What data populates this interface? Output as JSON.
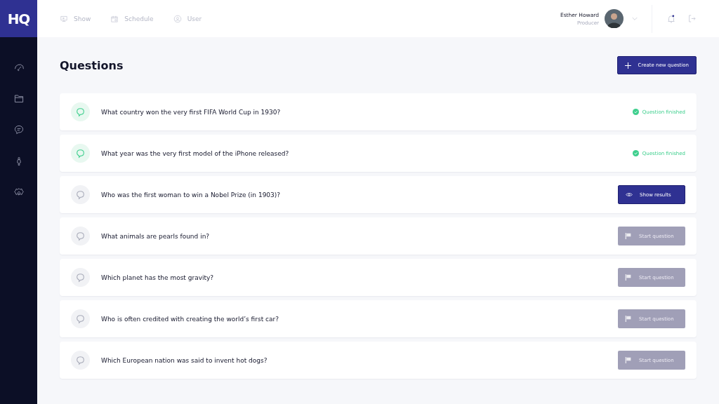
{
  "logo": "HQ",
  "nav": [
    {
      "label": "Show"
    },
    {
      "label": "Schedule"
    },
    {
      "label": "User"
    }
  ],
  "user": {
    "name": "Esther Howard",
    "role": "Producer"
  },
  "notifications": {
    "unread": true
  },
  "page_title": "Questions",
  "create_button": "Create new question",
  "questions": [
    {
      "text": "What country won the very first FIFA World Cup in 1930?",
      "kind": "finished",
      "action": "Question finished"
    },
    {
      "text": "What year was the very first model of the iPhone released?",
      "kind": "finished",
      "action": "Question finished"
    },
    {
      "text": "Who was the first woman to win a Nobel Prize (in 1903)?",
      "kind": "results",
      "action": "Show results"
    },
    {
      "text": "What animals are pearls found in?",
      "kind": "start",
      "action": "Start question"
    },
    {
      "text": "Which planet has the most gravity?",
      "kind": "start",
      "action": "Start question"
    },
    {
      "text": "Who is often credited with creating the world’s first car?",
      "kind": "start",
      "action": "Start question"
    },
    {
      "text": "Which European nation was said to invent hot dogs?",
      "kind": "start",
      "action": "Start question"
    }
  ]
}
